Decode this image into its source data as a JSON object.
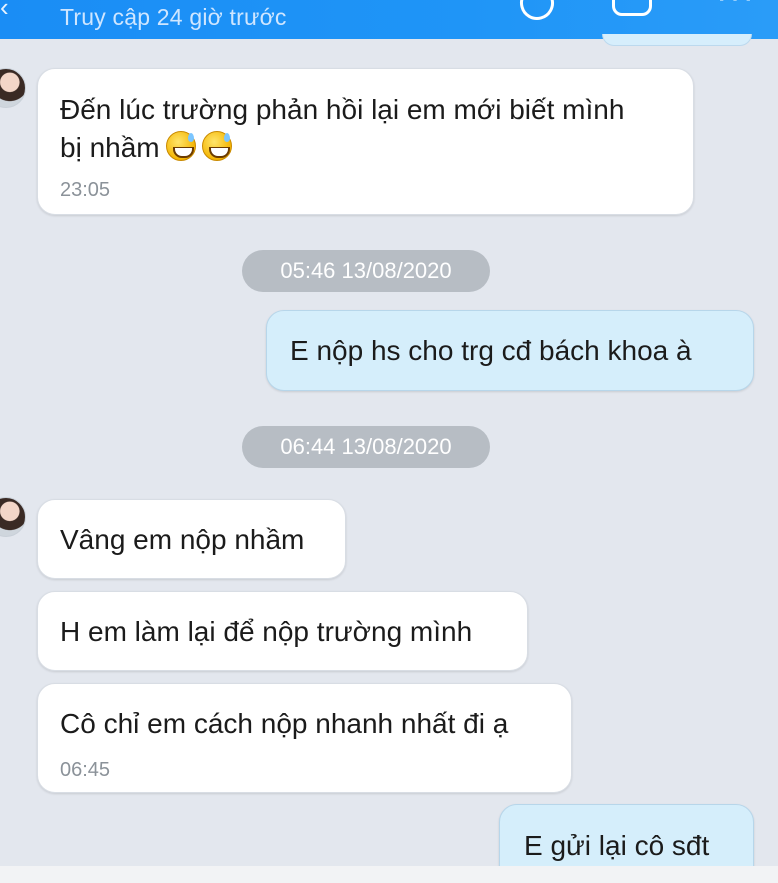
{
  "header": {
    "status": "Truy cập 24 giờ trước"
  },
  "messages": [
    {
      "text_line1": "Đến lúc trường phản hồi lại em mới biết mình",
      "text_line2": "bị nhầm",
      "emoji": [
        "grinning-sweat-emoji",
        "grinning-sweat-emoji"
      ],
      "time": "23:05"
    },
    {
      "date": "05:46 13/08/2020"
    },
    {
      "text": "E nộp hs cho trg cđ bách khoa à"
    },
    {
      "date": "06:44 13/08/2020"
    },
    {
      "text": "Vâng em nộp nhầm"
    },
    {
      "text": "H em làm lại để nộp trường mình"
    },
    {
      "text": "Cô chỉ em cách nộp nhanh nhất đi ạ",
      "time": "06:45"
    },
    {
      "text": "E gửi  lại cô sđt"
    }
  ],
  "colors": {
    "header": "#1f95f7",
    "background": "#e3e7ee",
    "incoming_bubble": "#ffffff",
    "outgoing_bubble": "#d5eefb",
    "date_pill": "#b7bdc4"
  }
}
